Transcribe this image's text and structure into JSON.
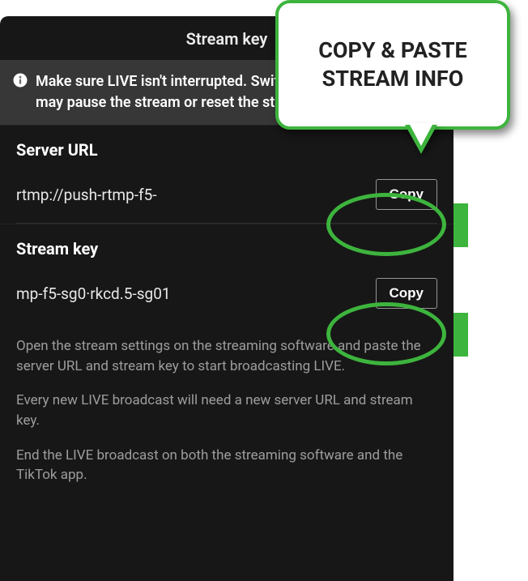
{
  "header": {
    "title": "Stream key"
  },
  "warning": {
    "text": "Make sure LIVE isn't interrupted. Switching apps during LIVE may pause the stream or reset the stream key."
  },
  "server": {
    "label": "Server URL",
    "value": "rtmp://push-rtmp-f5-",
    "copy_label": "Copy"
  },
  "key": {
    "label": "Stream key",
    "value": "mp-f5-sg0·rkcd.5-sg01",
    "copy_label": "Copy"
  },
  "info": {
    "p1": "Open the stream settings on the streaming software and paste the server URL and stream key to start broadcasting LIVE.",
    "p2": "Every new LIVE broadcast will need a new server URL and stream key.",
    "p3": "End the LIVE broadcast on both the streaming software and the TikTok app."
  },
  "callout": {
    "text": "COPY & PASTE STREAM INFO"
  }
}
